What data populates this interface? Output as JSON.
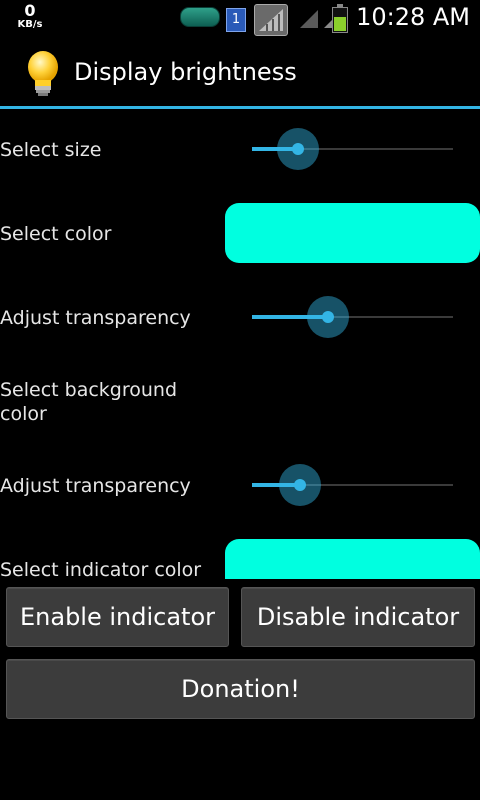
{
  "status_bar": {
    "net_speed_value": "0",
    "net_speed_unit": "KB/s",
    "notification_count": "1",
    "time": "10:28 AM",
    "icons": [
      "app-pill-icon",
      "notification-number-icon",
      "gallery-icon",
      "wifi-icon",
      "signal-icon",
      "battery-icon"
    ]
  },
  "title_bar": {
    "title": "Display brightness",
    "icon": "lightbulb-icon",
    "accent_color": "#33b5e5"
  },
  "settings": {
    "select_size": {
      "label": "Select size",
      "value_fraction": 0.23
    },
    "select_color": {
      "label": "Select color",
      "swatch_color": "#00ffe0"
    },
    "adjust_transparency_1": {
      "label": "Adjust transparency",
      "value_fraction": 0.38
    },
    "select_background_color": {
      "label_line1": "Select background",
      "label_line2": "color"
    },
    "adjust_transparency_2": {
      "label": "Adjust transparency",
      "value_fraction": 0.24
    },
    "select_indicator_color": {
      "label": "Select indicator color",
      "swatch_color": "#00ffe0"
    }
  },
  "buttons": {
    "enable_indicator": "Enable indicator",
    "disable_indicator": "Disable indicator",
    "donation": "Donation!"
  }
}
